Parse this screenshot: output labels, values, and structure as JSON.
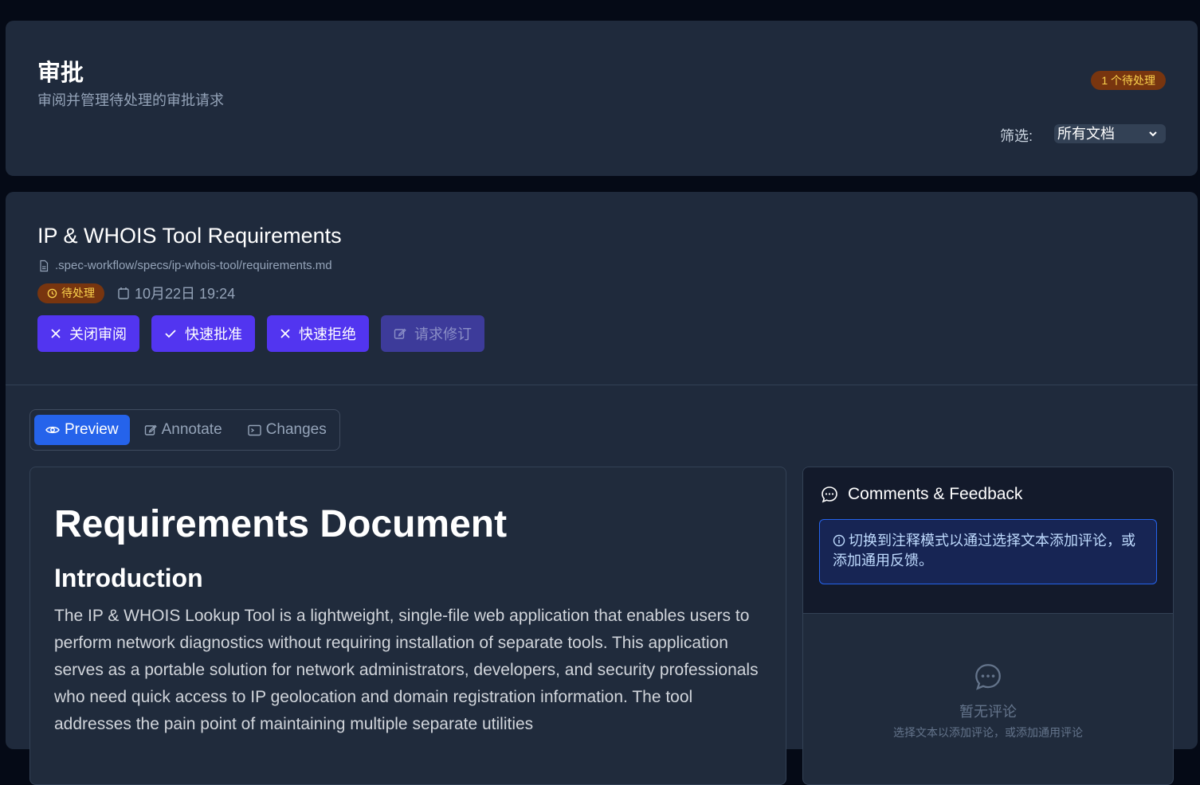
{
  "header": {
    "title": "审批",
    "subtitle": "审阅并管理待处理的审批请求",
    "pending_badge": "1 个待处理",
    "filter_label": "筛选:",
    "filter_value": "所有文档"
  },
  "approval": {
    "doc_title": "IP & WHOIS Tool Requirements",
    "doc_path": ".spec-workflow/specs/ip-whois-tool/requirements.md",
    "status": "待处理",
    "date": "10月22日 19:24",
    "actions": {
      "close": "关闭审阅",
      "approve": "快速批准",
      "reject": "快速拒绝",
      "revise": "请求修订"
    }
  },
  "tabs": {
    "preview": "Preview",
    "annotate": "Annotate",
    "changes": "Changes"
  },
  "document": {
    "h1": "Requirements Document",
    "h2": "Introduction",
    "paragraph": "The IP & WHOIS Lookup Tool is a lightweight, single-file web application that enables users to perform network diagnostics without requiring installation of separate tools. This application serves as a portable solution for network administrators, developers, and security professionals who need quick access to IP geolocation and domain registration information. The tool addresses the pain point of maintaining multiple separate utilities"
  },
  "comments": {
    "title": "Comments & Feedback",
    "info": "切换到注释模式以通过选择文本添加评论，或添加通用反馈。",
    "empty_title": "暂无评论",
    "empty_hint": "选择文本以添加评论，或添加通用评论"
  },
  "colors": {
    "accent_button": "#5235f0",
    "tab_active": "#2563eb",
    "pending_bg": "#78350f",
    "pending_text": "#fcd34d"
  }
}
